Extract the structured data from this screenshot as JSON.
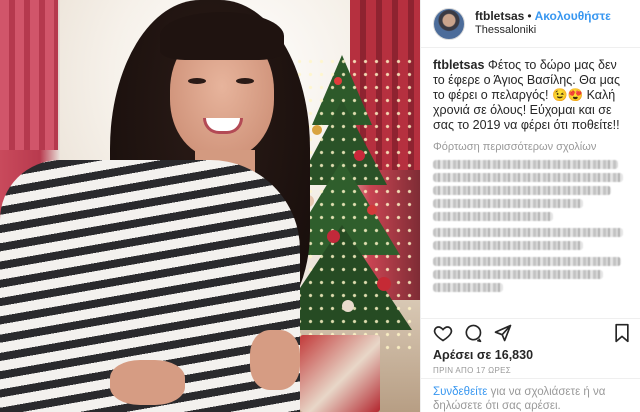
{
  "post": {
    "username": "ftbletsas",
    "separator": "•",
    "follow_label": "Ακολουθήστε",
    "location": "Thessaloniki",
    "caption_user": "ftbletsas",
    "caption_text": "Φέτος το δώρο μας δεν το έφερε ο Άγιος Βασίλης. Θα μας το φέρει ο πελαργός! 😉😍 Καλή χρονιά σε όλους! Εύχομαι και σε σας το 2019 να φέρει ότι ποθείτε!!",
    "load_more_comments": "Φόρτωση περισσότερων σχολίων",
    "likes_text": "Αρέσει σε 16,830",
    "timestamp": "ΠΡΙΝ ΑΠΟ 17 ΩΡΕΣ",
    "login_link": "Συνδεθείτε",
    "login_text": " για να σχολιάσετε ή να δηλώσετε ότι σας αρέσει."
  },
  "icons": {
    "like": "heart-icon",
    "comment": "comment-icon",
    "share": "share-icon",
    "save": "bookmark-icon"
  },
  "colors": {
    "link_blue": "#3897f0",
    "text": "#262626",
    "muted": "#999999",
    "border": "#efefef"
  }
}
